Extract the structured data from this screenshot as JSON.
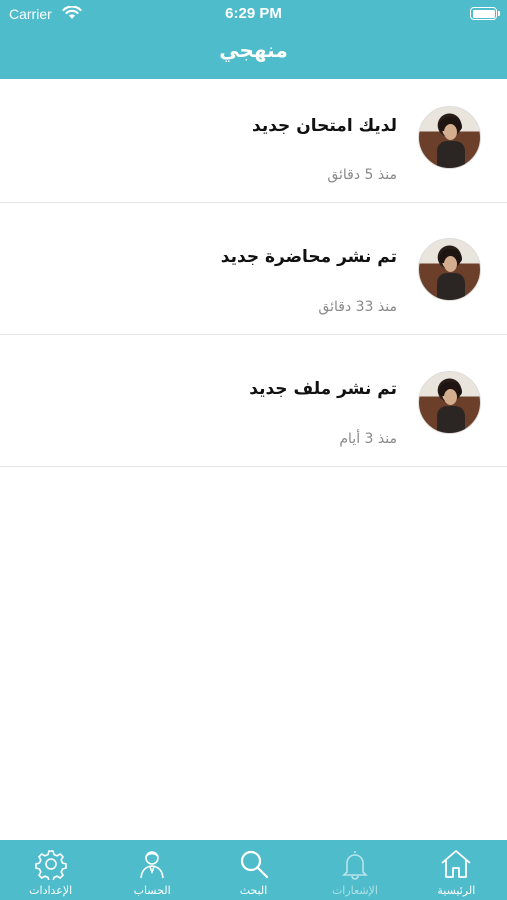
{
  "status": {
    "carrier": "Carrier",
    "time": "6:29 PM"
  },
  "nav": {
    "title": "منهجي"
  },
  "notifications": [
    {
      "title": "لديك امتحان جديد",
      "time": "منذ 5 دقائق"
    },
    {
      "title": "تم نشر محاضرة جديد",
      "time": "منذ 33 دقائق"
    },
    {
      "title": "تم نشر ملف جديد",
      "time": "منذ 3 أيام"
    }
  ],
  "tabs": [
    {
      "label": "الإعدادات",
      "icon": "gear-icon"
    },
    {
      "label": "الحساب",
      "icon": "person-icon"
    },
    {
      "label": "البحث",
      "icon": "search-icon"
    },
    {
      "label": "الإشعارات",
      "icon": "bell-icon"
    },
    {
      "label": "الرئيسية",
      "icon": "home-icon"
    }
  ],
  "colors": {
    "accent": "#4fbccb"
  }
}
